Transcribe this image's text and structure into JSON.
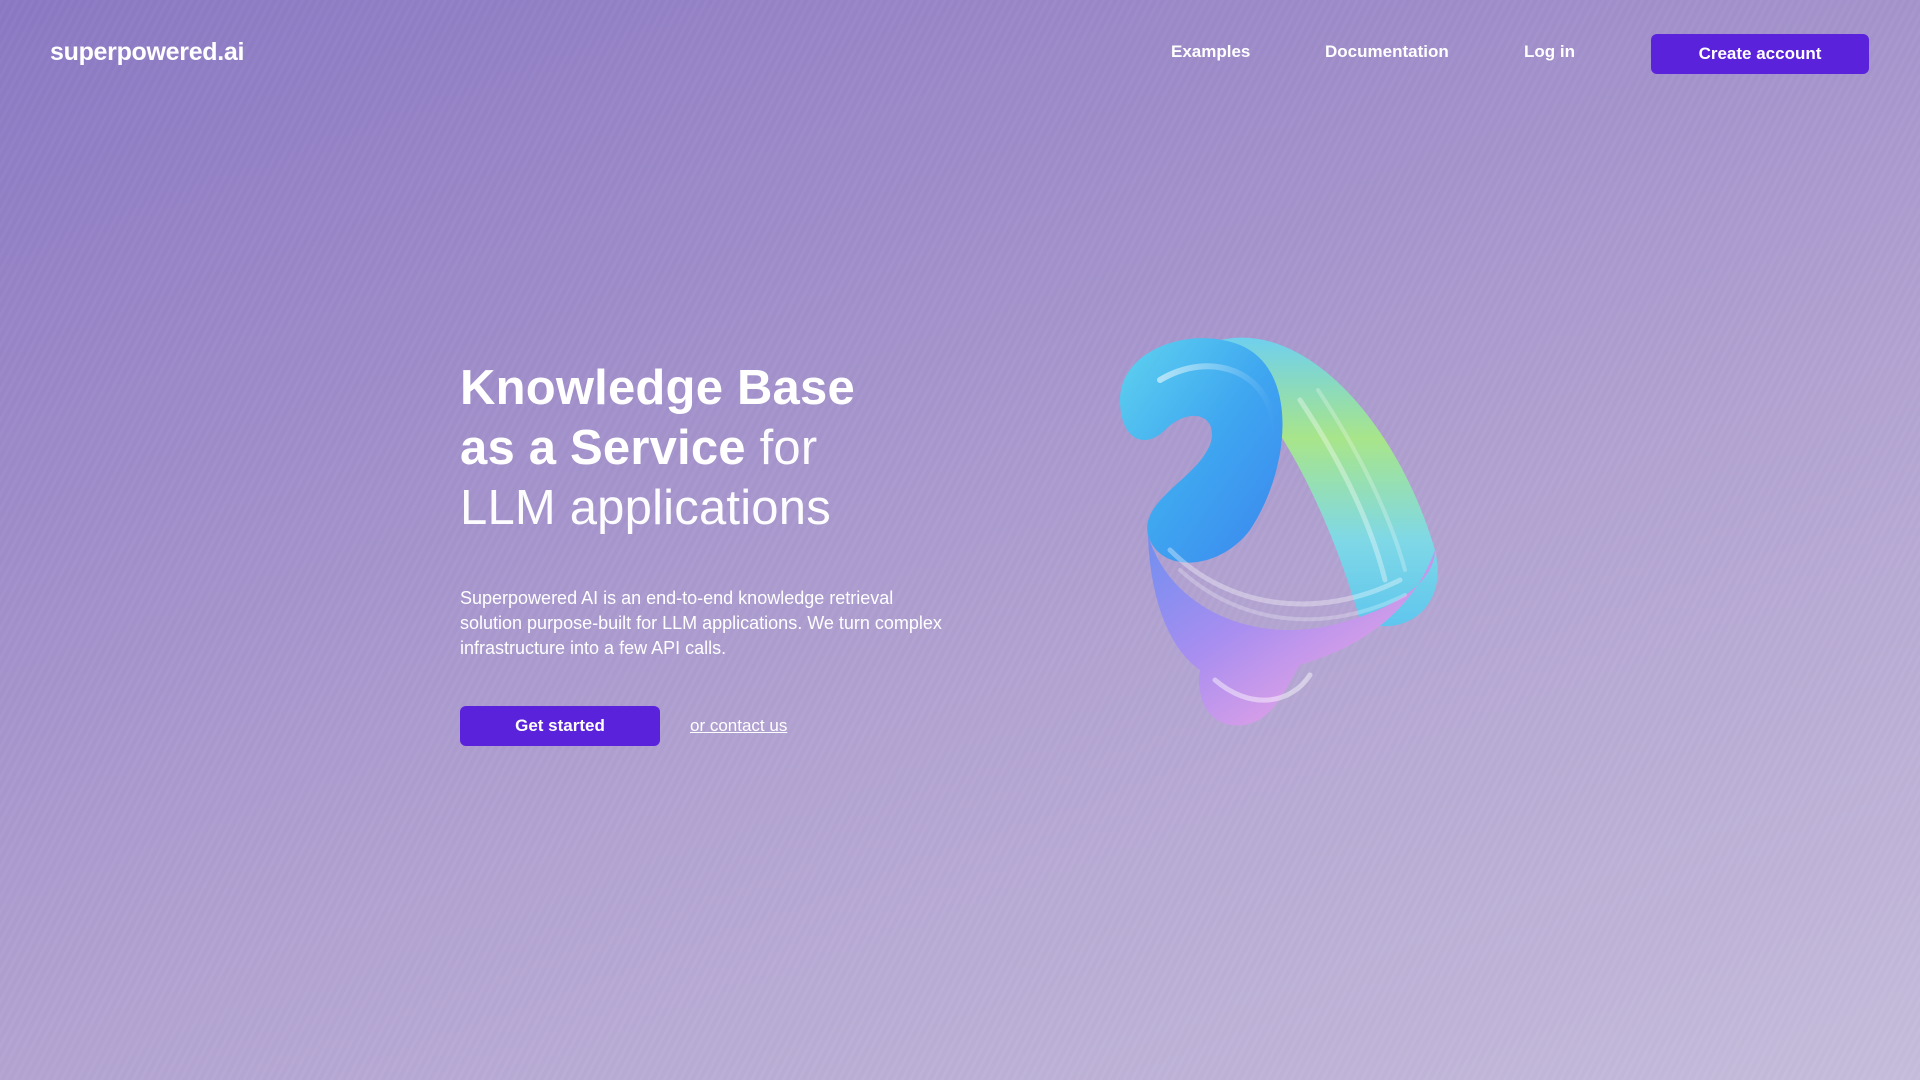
{
  "header": {
    "logo": "superpowered.ai",
    "nav": {
      "examples": "Examples",
      "documentation": "Documentation",
      "login": "Log in"
    },
    "create_account": "Create account"
  },
  "hero": {
    "title_line1": "Knowledge Base",
    "title_line2_strong": "as a Service",
    "title_line2_light": "for",
    "title_line3": "LLM applications",
    "description": "Superpowered AI is an end-to-end knowledge retrieval solution purpose-built for LLM applications. We turn complex infrastructure into a few API calls.",
    "cta_primary": "Get started",
    "cta_secondary": "or contact us"
  },
  "colors": {
    "accent": "#5b22dc",
    "background_start": "#8b79c4",
    "background_end": "#c6bddc"
  },
  "art": {
    "icon": "iridescent-twisted-ribbon-3d-shape"
  }
}
